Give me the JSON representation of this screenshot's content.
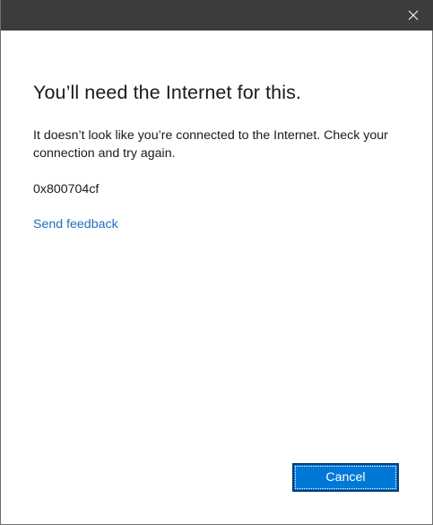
{
  "titlebar": {
    "close_icon": "close-icon",
    "background": "#3c3c3c"
  },
  "dialog": {
    "heading": "You’ll need the Internet for this.",
    "message": "It doesn’t look like you’re connected to the Internet. Check your connection and try again.",
    "error_code": "0x800704cf",
    "feedback_link": "Send feedback",
    "cancel_label": "Cancel"
  },
  "colors": {
    "accent": "#0078d7",
    "link": "#1e6fc0",
    "text": "#1a1a1a"
  }
}
